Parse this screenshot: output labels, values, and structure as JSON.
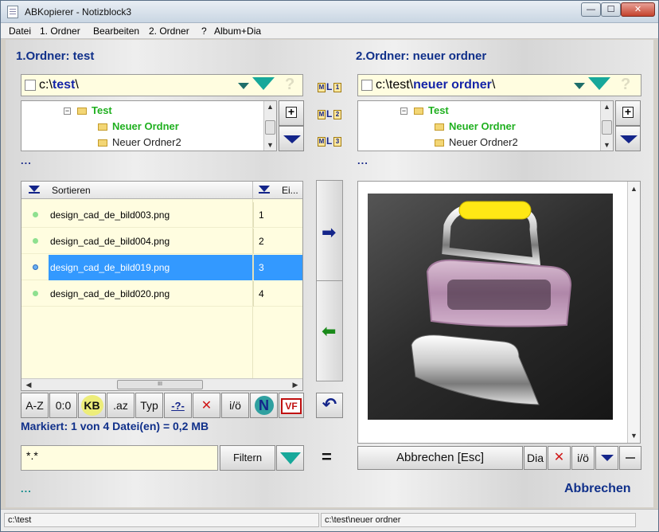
{
  "window": {
    "title": "ABKopierer - Notizblock3"
  },
  "menu": [
    "Datei",
    "1. Ordner",
    "Bearbeiten",
    "2. Ordner",
    "?",
    "Album+Dia"
  ],
  "left": {
    "title": "1.Ordner: test",
    "path_prefix": "c:\\",
    "path_bold": "test",
    "path_suffix": "\\",
    "tree": [
      {
        "label": "Test",
        "style": "green"
      },
      {
        "label": "Neuer Ordner",
        "style": "green"
      },
      {
        "label": "Neuer Ordner2",
        "style": "plain"
      }
    ],
    "dots": "...",
    "list": {
      "header_sort": "Sortieren",
      "header_col2": "Ei...",
      "rows": [
        {
          "name": "design_cad_de_bild003.png",
          "num": "1",
          "selected": false
        },
        {
          "name": "design_cad_de_bild004.png",
          "num": "2",
          "selected": false
        },
        {
          "name": "design_cad_de_bild019.png",
          "num": "3",
          "selected": true
        },
        {
          "name": "design_cad_de_bild020.png",
          "num": "4",
          "selected": false
        }
      ],
      "hscroll_thumb": "III"
    },
    "toolbar": {
      "az": "A-Z",
      "zero": "0:0",
      "kb": "KB",
      "ext": ".az",
      "typ": "Typ",
      "q": "-?-",
      "x": "✕",
      "io": "i/ö",
      "n": "N",
      "vf": "VF"
    },
    "marked": "Markiert: 1 von 4 Datei(en) = 0,2 MB",
    "filter_value": "*.*",
    "filter_button": "Filtern",
    "bottom_dots": "..."
  },
  "middle": {
    "links": [
      {
        "m": "M",
        "l": "L",
        "n": "1"
      },
      {
        "m": "M",
        "l": "L",
        "n": "2"
      },
      {
        "m": "M",
        "l": "L",
        "n": "3"
      }
    ],
    "arrow_right": "➡",
    "arrow_left": "⬅",
    "undo": "↶",
    "equals": "="
  },
  "right": {
    "title": "2.Ordner: neuer ordner",
    "path_prefix": "c:\\test\\",
    "path_bold": "neuer ordner",
    "path_suffix": "\\",
    "tree": [
      {
        "label": "Test",
        "style": "green"
      },
      {
        "label": "Neuer Ordner",
        "style": "green"
      },
      {
        "label": "Neuer Ordner2",
        "style": "plain"
      }
    ],
    "dots": "...",
    "bottom": {
      "abbrechen_esc": "Abbrechen [Esc]",
      "dia": "Dia",
      "x": "✕",
      "io": "i/ö"
    },
    "cancel_link": "Abbrechen"
  },
  "status": {
    "left": "c:\\test",
    "right": "c:\\test\\neuer ordner"
  },
  "help": "?",
  "colors": {
    "title_blue": "#10308a",
    "tree_green": "#20b020",
    "selection": "#3399ff",
    "list_bg": "#fffde0",
    "teal_arrow": "#17a89a"
  }
}
